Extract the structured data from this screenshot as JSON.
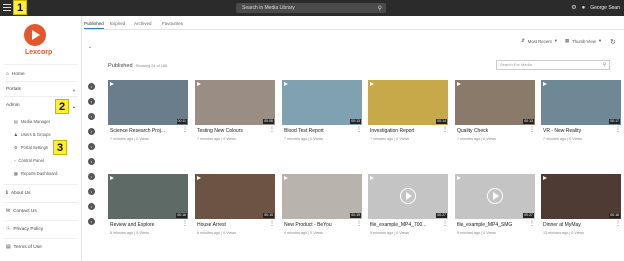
{
  "topbar": {
    "search_placeholder": "Search in Media Library",
    "user_name": "George Sean"
  },
  "badges": [
    "1",
    "2",
    "3"
  ],
  "sidebar": {
    "brand": "Lexcorp",
    "items": {
      "home": "Home",
      "portals": "Portals",
      "admin": "Admin",
      "about": "About Us",
      "contact": "Contact Us",
      "privacy": "Privacy Policy",
      "terms": "Terms of Use"
    },
    "admin_sub": [
      "Media Manager",
      "Users & Groups",
      "Portal Settings",
      "Control Panel",
      "Reports Dashboard"
    ]
  },
  "tabs": [
    "Published",
    "Expired",
    "Archived",
    "Favourites"
  ],
  "toolbar": {
    "sort_label": "Most Recent",
    "view_label": "Thumb View"
  },
  "section": {
    "title": "Published",
    "showing": "Showing 24 of 188"
  },
  "media_search_placeholder": "Search For Media",
  "cards": [
    {
      "title": "Science Research Proj...",
      "meta": "7 minutes ago | 0 Views",
      "duration": "00:11",
      "color": "#6a7d8a"
    },
    {
      "title": "Testing New Colours",
      "meta": "7 minutes ago | 0 Views",
      "duration": "00:06",
      "color": "#9a8e84"
    },
    {
      "title": "Blood Test Report",
      "meta": "7 minutes ago | 0 Views",
      "duration": "00:13",
      "color": "#7fa1b0"
    },
    {
      "title": "Investigation Report",
      "meta": "7 minutes ago | 0 Views",
      "duration": "00:14",
      "color": "#c8a94a"
    },
    {
      "title": "Quality Check",
      "meta": "7 minutes ago | 0 Views",
      "duration": "00:13",
      "color": "#8a7a6a"
    },
    {
      "title": "VR - New Reality",
      "meta": "7 minutes ago | 0 Views",
      "duration": "00:17",
      "color": "#6f8896"
    },
    {
      "title": "Review and Explore",
      "meta": "8 minutes ago | 0 Views",
      "duration": "00:16",
      "color": "#5e6a66"
    },
    {
      "title": "House Arrest",
      "meta": "8 minutes ago | 0 Views",
      "duration": "00:15",
      "color": "#6b5444"
    },
    {
      "title": "New Product - BeYou",
      "meta": "9 minutes ago | 0 Views",
      "duration": "00:19",
      "color": "#b9b3ad"
    },
    {
      "title": "file_example_MP4_700...",
      "meta": "9 minutes ago | 0 Views",
      "duration": "00:27",
      "color": "#c4c4c4"
    },
    {
      "title": "file_example_MP4_SMG",
      "meta": "9 minutes ago | 0 Views",
      "duration": "00:27",
      "color": "#c4c4c4"
    },
    {
      "title": "Dinner at MyMay",
      "meta": "13 minutes ago | 0 Views",
      "duration": "00:16",
      "color": "#4d3b34"
    }
  ]
}
